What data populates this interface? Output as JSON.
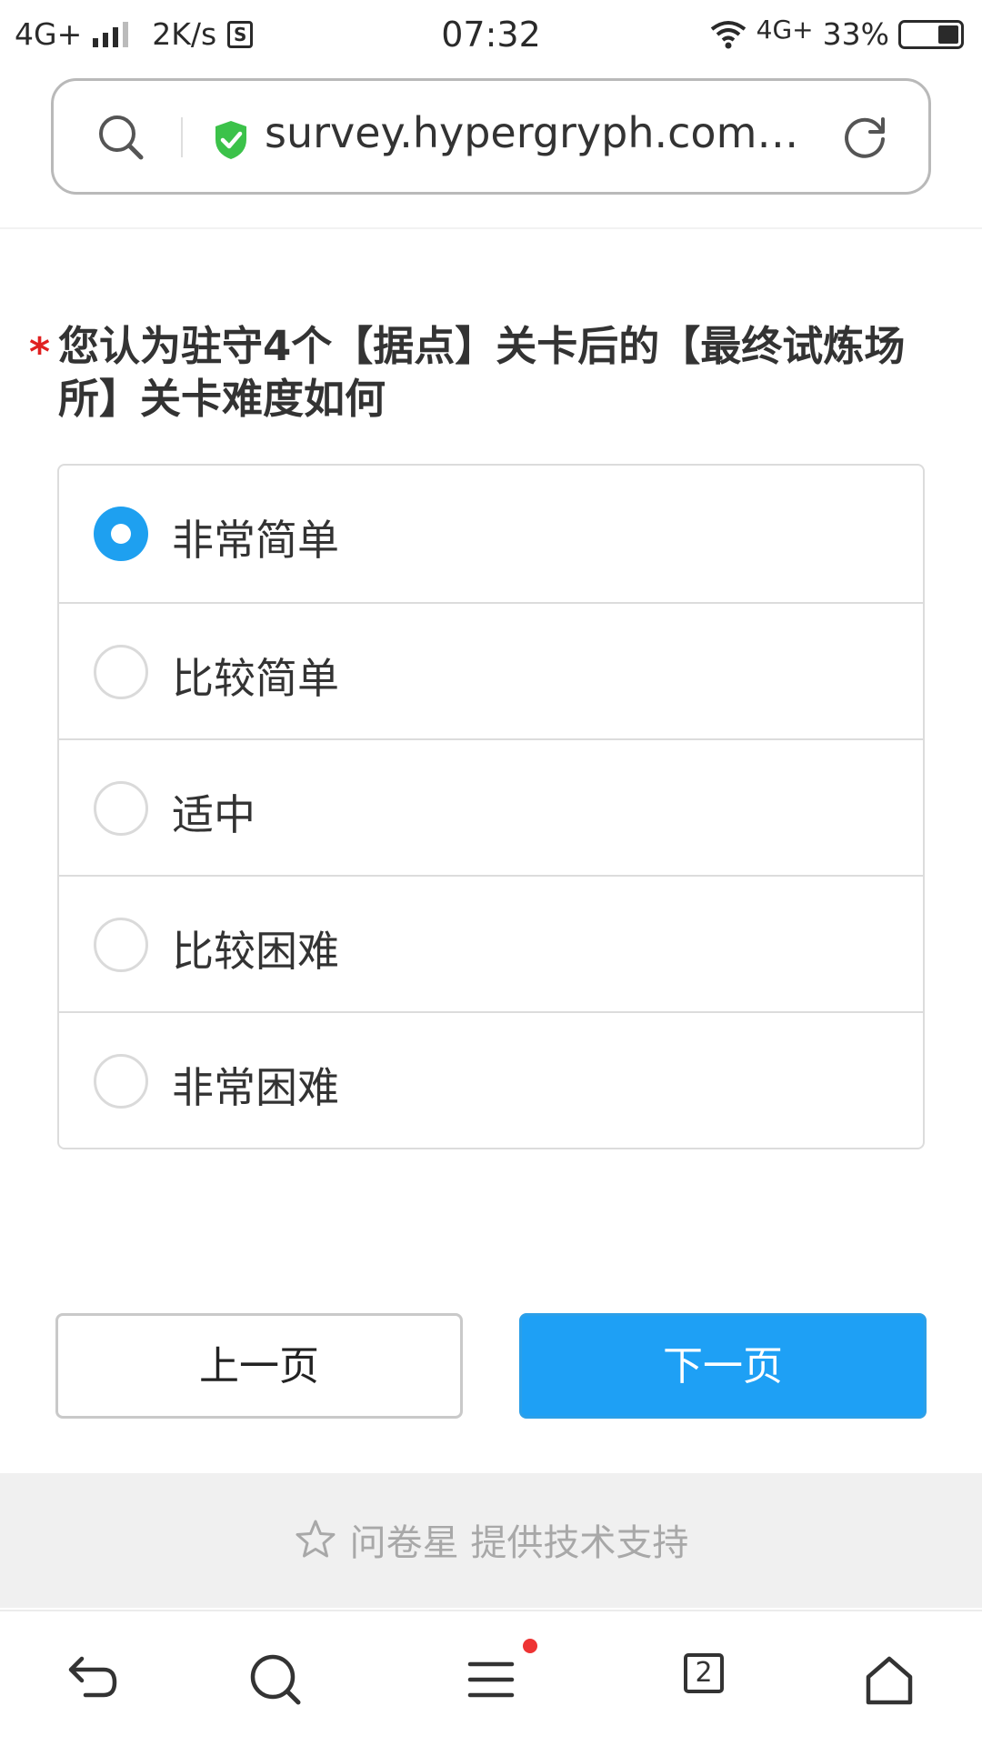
{
  "status_bar": {
    "network": "4G+",
    "speed": "2K/s",
    "sim_icon": "S",
    "time": "07:32",
    "wifi_network": "4G+",
    "battery": "33%"
  },
  "url_bar": {
    "url": "survey.hypergryph.com/v…",
    "secure": true,
    "icons": [
      "search-icon",
      "shield-icon",
      "reload-icon"
    ]
  },
  "question": {
    "required_mark": "*",
    "title": "您认为驻守4个【据点】关卡后的【最终试炼场所】关卡难度如何",
    "options": [
      {
        "label": "非常简单",
        "selected": true
      },
      {
        "label": "比较简单",
        "selected": false
      },
      {
        "label": "适中",
        "selected": false
      },
      {
        "label": "比较困难",
        "selected": false
      },
      {
        "label": "非常困难",
        "selected": false
      }
    ]
  },
  "buttons": {
    "prev": "上一页",
    "next": "下一页"
  },
  "footer": {
    "text": "问卷星 提供技术支持"
  },
  "bottom_nav": {
    "tab_count": "2",
    "icons": [
      "back-icon",
      "search-icon",
      "menu-icon",
      "tabs-icon",
      "home-icon"
    ]
  },
  "colors": {
    "accent": "#1ea0f5",
    "required": "#e02020",
    "secure": "#3cb371"
  }
}
